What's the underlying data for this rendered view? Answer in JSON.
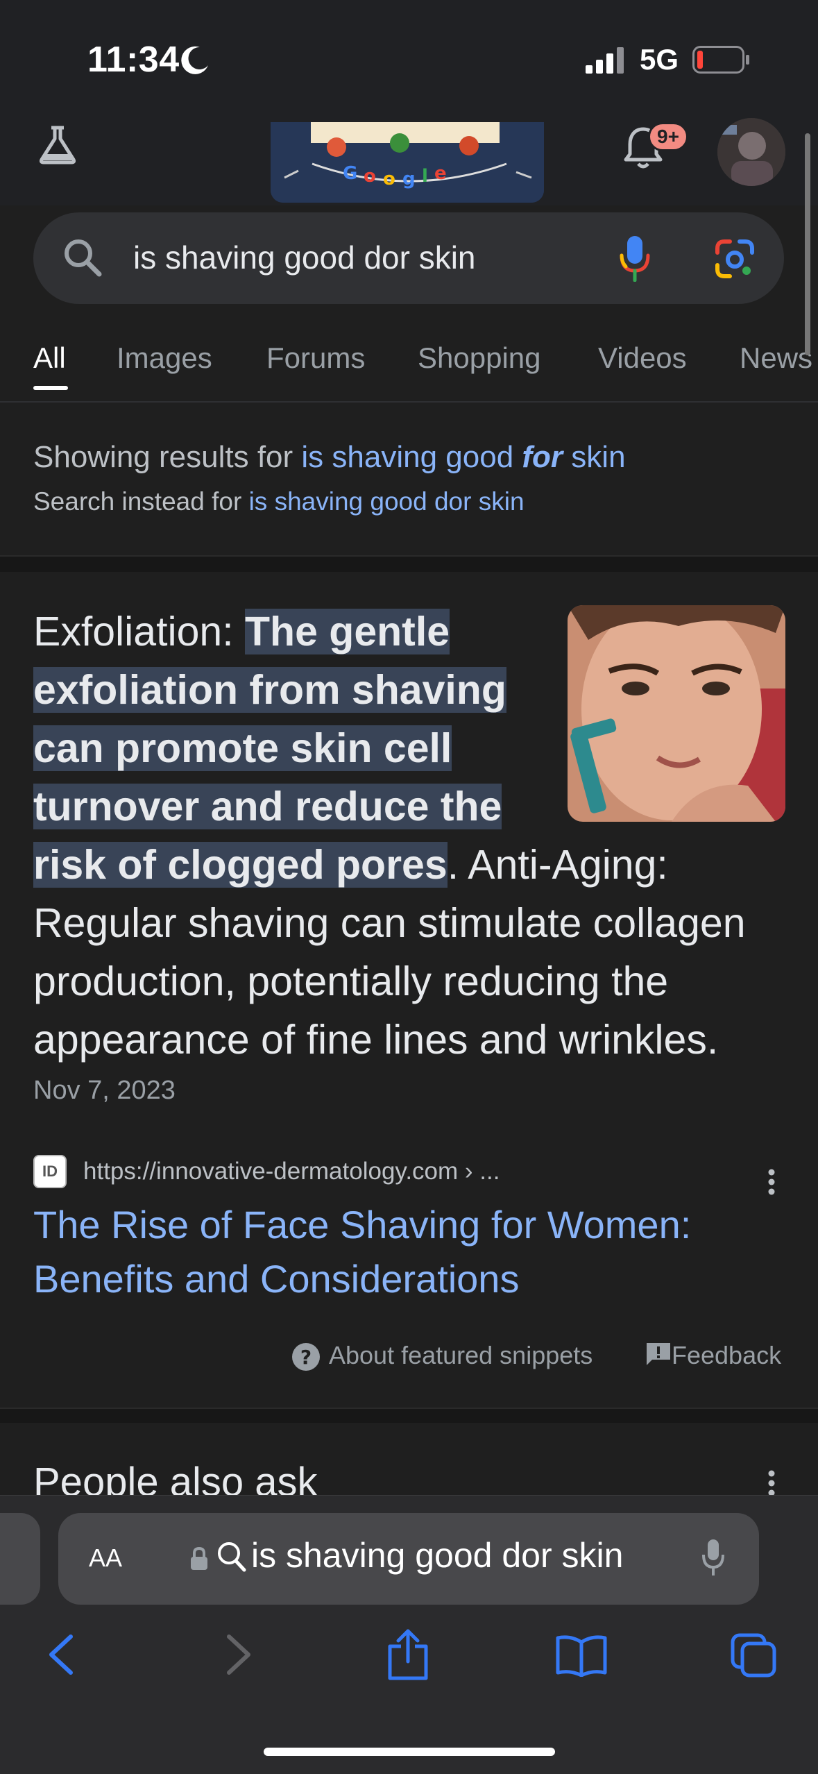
{
  "status_bar": {
    "time": "11:34",
    "network": "5G",
    "battery_color": "#ff453a"
  },
  "header": {
    "notification_count": "9+",
    "doodle_text": "Google"
  },
  "search": {
    "query": "is shaving good dor skin"
  },
  "tabs": [
    {
      "label": "All",
      "active": true
    },
    {
      "label": "Images"
    },
    {
      "label": "Forums"
    },
    {
      "label": "Shopping"
    },
    {
      "label": "Videos"
    },
    {
      "label": "News"
    }
  ],
  "spelling": {
    "showing_prefix": "Showing results for ",
    "corrected_part1": "is shaving good ",
    "corrected_bold": "for",
    "corrected_part2": " skin",
    "instead_prefix": "Search instead for ",
    "instead_query": "is shaving good dor skin"
  },
  "snippet": {
    "lead": "Exfoliation: ",
    "highlight": "The gentle exfoliation from shaving can promote skin cell turnover and reduce the risk of clogged pores",
    "rest": ". Anti-Aging: Regular shaving can stimulate collagen production, potentially reducing the appearance of fine lines and wrinkles.",
    "date": "Nov 7, 2023",
    "source_favicon_text": "ID",
    "source_url": "https://innovative-dermatology.com › ...",
    "title": "The Rise of Face Shaving for Women: Benefits and Considerations"
  },
  "footer_links": {
    "about": "About featured snippets",
    "feedback": "Feedback"
  },
  "people_also_ask": {
    "heading": "People also ask"
  },
  "safari": {
    "aa_label": "AA",
    "address_text": "is shaving good dor skin"
  },
  "colors": {
    "link": "#8ab4f8",
    "highlight_bg": "#394457",
    "background": "#1f1f1f",
    "ios_blue": "#3478f6"
  }
}
